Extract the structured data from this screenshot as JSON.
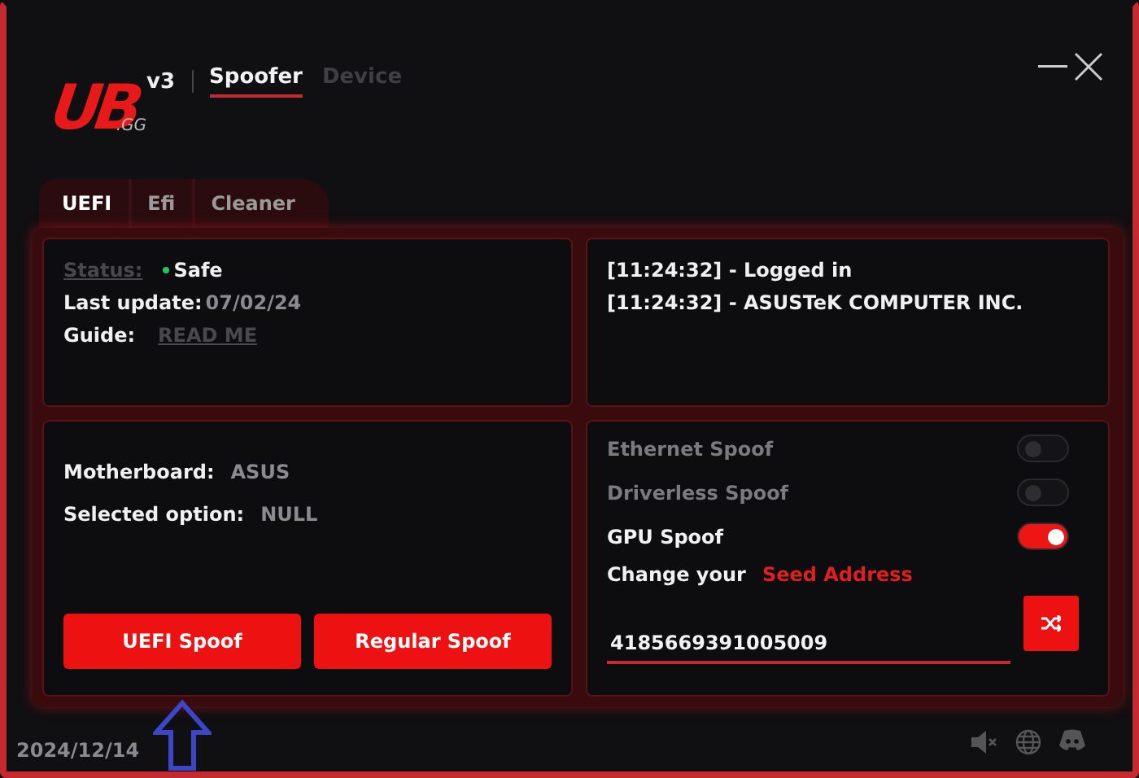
{
  "logo": {
    "mark": "UB",
    "suffix": ".GG",
    "version": "v3"
  },
  "nav": [
    {
      "label": "Spoofer",
      "selected": true
    },
    {
      "label": "Device",
      "selected": false
    }
  ],
  "tabs": [
    {
      "label": "UEFI",
      "selected": true
    },
    {
      "label": "Efi",
      "selected": false
    },
    {
      "label": "Cleaner",
      "selected": false
    }
  ],
  "status_panel": {
    "status_label": "Status:",
    "status_value": "Safe",
    "color": "#22c55e",
    "update_label": "Last update:",
    "update_value": "07/02/24",
    "guide_label": "Guide:",
    "guide_link": "READ ME"
  },
  "log": [
    "[11:24:32] - Logged in",
    "[11:24:32] - ASUSTeK COMPUTER INC."
  ],
  "info_panel": {
    "rows": [
      {
        "label": "Motherboard:",
        "value": "ASUS"
      },
      {
        "label": "Selected option:",
        "value": "NULL"
      }
    ],
    "buttons": [
      "UEFI Spoof",
      "Regular Spoof"
    ]
  },
  "options": [
    {
      "label": "Ethernet Spoof",
      "on": false
    },
    {
      "label": "Driverless Spoof",
      "on": false
    },
    {
      "label": "GPU Spoof",
      "on": true
    }
  ],
  "seed": {
    "prefix": "Change your",
    "highlight": "Seed Address",
    "value": "4185669391005009"
  },
  "footer": {
    "date": "2024/12/14"
  }
}
